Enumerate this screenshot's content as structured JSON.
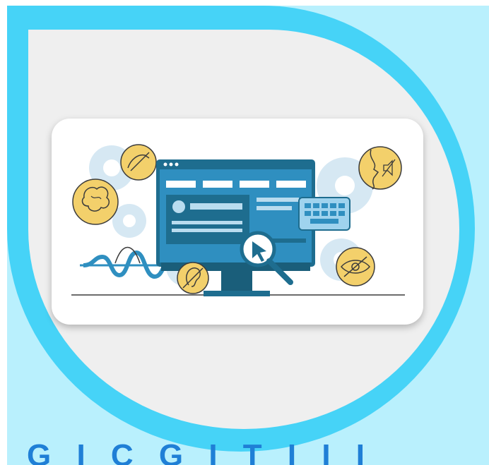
{
  "colors": {
    "panel_background": "#b9f0fd",
    "ring": "#46d3f7",
    "inner_background": "#efefef",
    "card_background": "#ffffff",
    "monitor_dark": "#1e6d8f",
    "monitor_screen": "#2f8fc0",
    "accent_yellow": "#f3d06b",
    "gear_light": "#d6e8f3",
    "bottom_text": "#1f7fd6"
  },
  "illustration": {
    "icons": [
      "brain-icon",
      "no-touch-hand-icon",
      "mute-speech-icon",
      "hidden-eye-icon",
      "no-hearing-ear-icon",
      "cursor-icon",
      "magnifier-icon",
      "keyboard-icon",
      "gear-icon"
    ]
  },
  "bottom_banner": {
    "text": "G I C G I T I I I"
  }
}
